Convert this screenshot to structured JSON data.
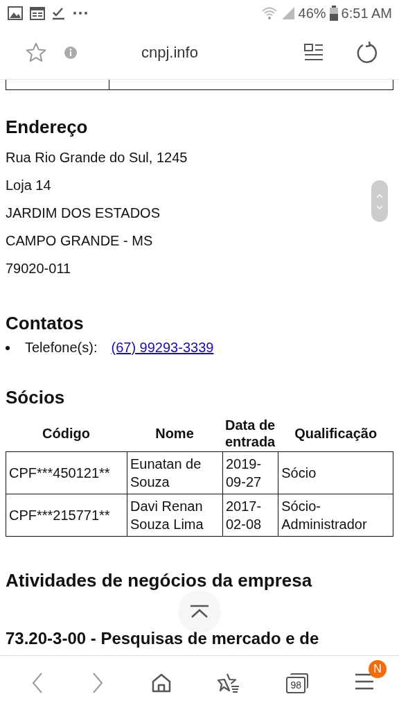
{
  "status_bar": {
    "battery": "46%",
    "time": "6:51 AM"
  },
  "toolbar": {
    "url": "cnpj.info"
  },
  "address": {
    "heading": "Endereço",
    "lines": [
      "Rua Rio Grande do Sul, 1245",
      "Loja 14",
      "JARDIM DOS ESTADOS",
      "CAMPO GRANDE - MS",
      "79020-011"
    ]
  },
  "contacts": {
    "heading": "Contatos",
    "items": [
      {
        "label": "Telefone(s):",
        "link": "(67) 99293-3339"
      }
    ]
  },
  "partners": {
    "heading": "Sócios",
    "columns": [
      "Código",
      "Nome",
      "Data de entrada",
      "Qualificação"
    ],
    "rows": [
      [
        "CPF***450121**",
        "Eunatan de Souza",
        "2019-09-27",
        "Sócio"
      ],
      [
        "CPF***215771**",
        "Davi Renan Souza Lima",
        "2017-02-08",
        "Sócio-Administrador"
      ]
    ]
  },
  "activities": {
    "heading": "Atividades de negócios da empresa",
    "first_item": "73.20-3-00 - Pesquisas de mercado e de"
  },
  "bottom_nav": {
    "tabs_count": "98",
    "menu_badge": "N"
  }
}
